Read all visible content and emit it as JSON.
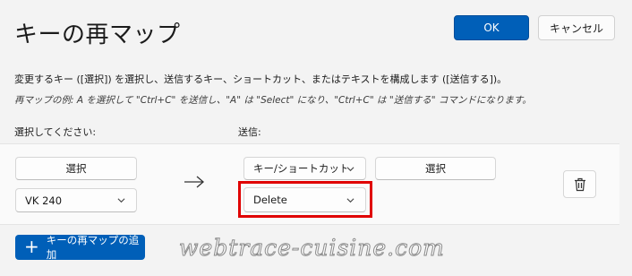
{
  "header": {
    "title": "キーの再マップ",
    "ok_label": "OK",
    "cancel_label": "キャンセル"
  },
  "description": "変更するキー ([選択]) を選択し、送信するキー、ショートカット、またはテキストを構成します ([送信する])。",
  "example": "再マップの例: A を選択して \"Ctrl+C\" を送信し、\"A\" は \"Select\" になり、\"Ctrl+C\" は \"送信する\" コマンドになります。",
  "columns": {
    "select_label": "選択してください:",
    "send_label": "送信:"
  },
  "row": {
    "source_select_button": "選択",
    "source_key_value": "VK 240",
    "target_type_value": "キー/ショートカットの送信",
    "target_select_button": "選択",
    "target_key_value": "Delete"
  },
  "add_button_label": "キーの再マップの追加",
  "watermark": "webtrace-cuisine.com",
  "colors": {
    "accent": "#005fb8",
    "highlight": "#e00000",
    "background": "#f3f3f3"
  }
}
